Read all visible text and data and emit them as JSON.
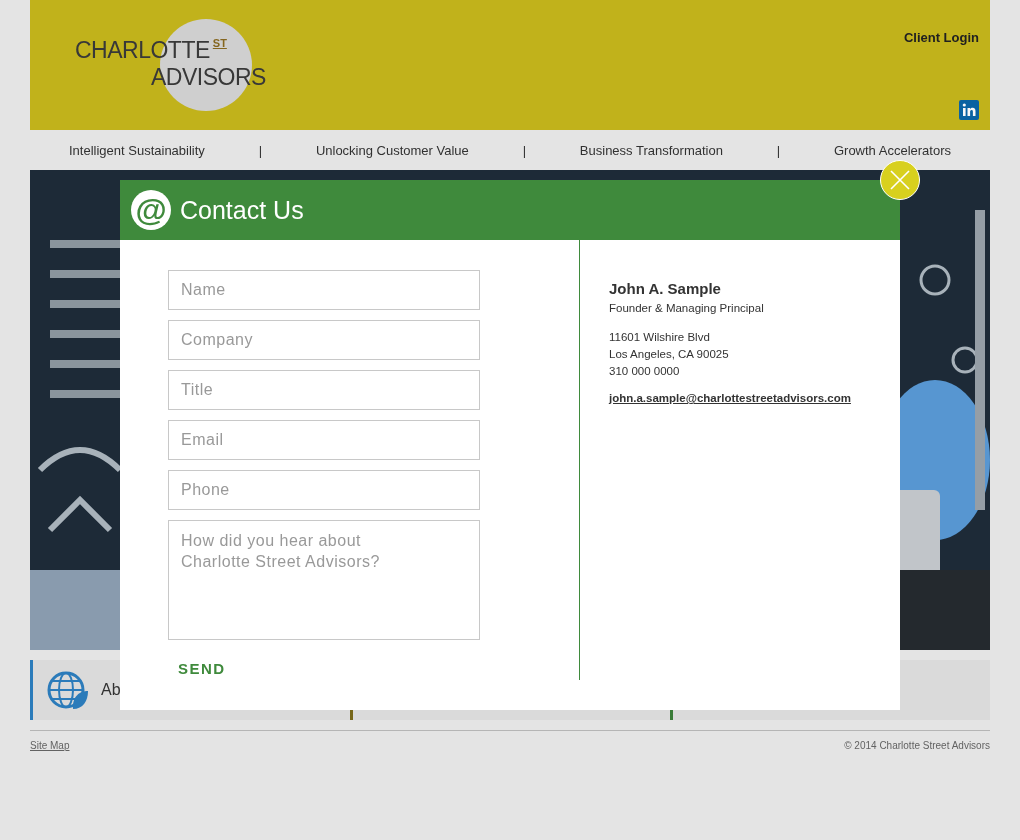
{
  "header": {
    "logo": {
      "line_1": "CHARLOTTE",
      "superscript": "ST",
      "line_2": "ADVISORS"
    },
    "client_login": "Client Login"
  },
  "nav": {
    "items": [
      {
        "label": "Intelligent Sustainability"
      },
      {
        "label": "Unlocking Customer Value"
      },
      {
        "label": "Business Transformation"
      },
      {
        "label": "Growth Accelerators"
      }
    ],
    "separator": "|"
  },
  "cards": [
    {
      "label": "Ab",
      "color": "#2d7fc0",
      "kind": "globe"
    },
    {
      "color": "#7a6a1a",
      "kind": "plain"
    },
    {
      "color": "#3c7f3a",
      "kind": "plain"
    }
  ],
  "footer": {
    "site_map": "Site Map",
    "copyright": "© 2014 Charlotte Street Advisors"
  },
  "modal": {
    "title": "Contact Us",
    "icon": "@",
    "fields": [
      {
        "placeholder": "Name",
        "kind": "input"
      },
      {
        "placeholder": "Company",
        "kind": "input"
      },
      {
        "placeholder": "Title",
        "kind": "input"
      },
      {
        "placeholder": "Email",
        "kind": "input"
      },
      {
        "placeholder": "Phone",
        "kind": "input"
      },
      {
        "placeholder": "How did you hear about\nCharlotte Street Advisors?",
        "kind": "textarea"
      }
    ],
    "send": "SEND",
    "contact": {
      "name": "John A. Sample",
      "role": "Founder & Managing Principal",
      "address": [
        "11601 Wilshire Blvd",
        "Los Angeles, CA 90025",
        "310 000 0000"
      ],
      "email": "john.a.sample@charlottestreetadvisors.com"
    }
  }
}
